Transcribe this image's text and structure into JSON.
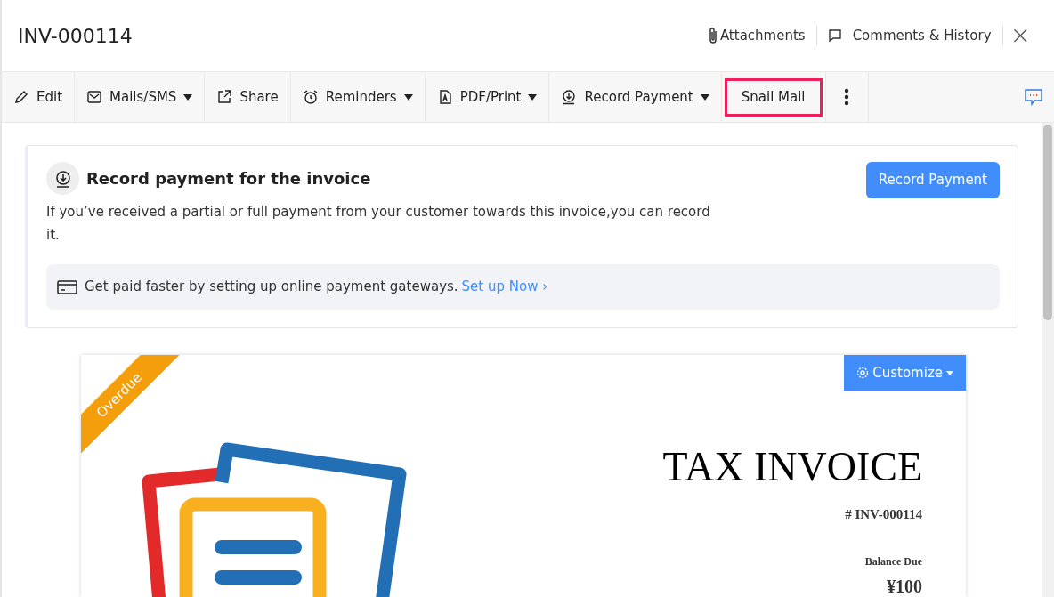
{
  "header": {
    "title": "INV-000114",
    "attachments": "Attachments",
    "comments": "Comments & History",
    "close": "×"
  },
  "toolbar": [
    {
      "label": "Edit",
      "dropdown": false,
      "highlighted": false
    },
    {
      "label": "Mails/SMS",
      "dropdown": true,
      "highlighted": false
    },
    {
      "label": "Share",
      "dropdown": false,
      "highlighted": false
    },
    {
      "label": "Reminders",
      "dropdown": true,
      "highlighted": false
    },
    {
      "label": "PDF/Print",
      "dropdown": true,
      "highlighted": false
    },
    {
      "label": "Record Payment",
      "dropdown": true,
      "highlighted": false
    },
    {
      "label": "Snail Mail",
      "dropdown": false,
      "highlighted": true
    }
  ],
  "banner": {
    "title": "Record payment for the invoice",
    "text": "If you’ve received a partial or full payment from your customer towards this invoice,you can record it.",
    "button": "Record Payment",
    "gateway_text": "Get paid faster by setting up online payment gateways.",
    "gateway_link": "Set up Now ›"
  },
  "invoice": {
    "ribbon": "Overdue",
    "customize": "Customize",
    "title": "TAX INVOICE",
    "number": "# INV-000114",
    "balance_label": "Balance Due",
    "balance": "¥100"
  }
}
